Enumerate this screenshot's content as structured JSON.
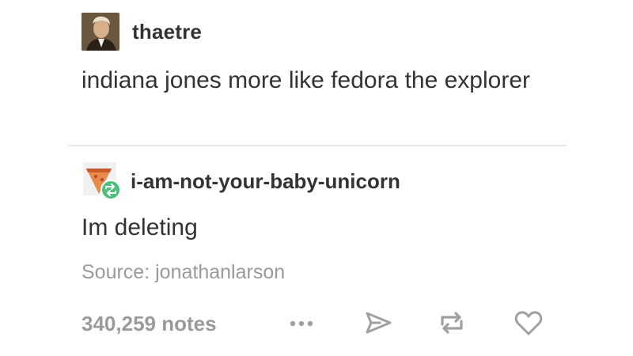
{
  "post": {
    "author": "thaetre",
    "text": "indiana jones more like fedora the explorer"
  },
  "reblog": {
    "author": "i-am-not-your-baby-unicorn",
    "text": "Im deleting"
  },
  "source": {
    "prefix": "Source:",
    "name": "jonathanlarson"
  },
  "footer": {
    "notes": "340,259 notes"
  },
  "icons": {
    "more": "more-dots-icon",
    "share": "share-paper-plane-icon",
    "reblog": "reblog-icon",
    "like": "heart-icon",
    "reblog_badge": "reblog-badge-icon"
  },
  "colors": {
    "text": "#333333",
    "muted": "#9a9a9a",
    "reblog_badge": "#4fbf7d",
    "icon": "#a0a0a0"
  }
}
